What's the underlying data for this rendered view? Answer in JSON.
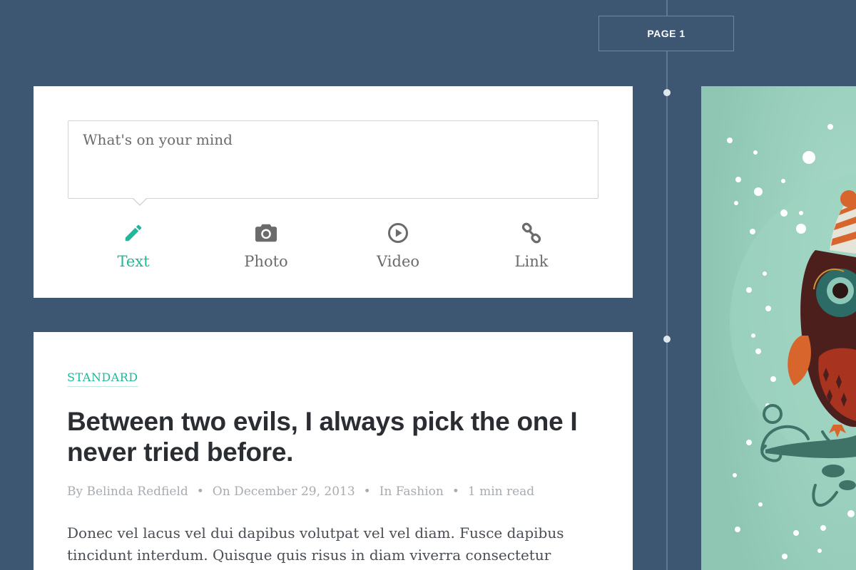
{
  "timeline": {
    "page_label": "PAGE 1"
  },
  "composer": {
    "placeholder": "What's on your mind",
    "post_types": [
      {
        "label": "Text",
        "icon": "pencil-icon",
        "active": true
      },
      {
        "label": "Photo",
        "icon": "camera-icon",
        "active": false
      },
      {
        "label": "Video",
        "icon": "play-circle-icon",
        "active": false
      },
      {
        "label": "Link",
        "icon": "link-icon",
        "active": false
      }
    ]
  },
  "article": {
    "category": "STANDARD",
    "title": "Between two evils, I always pick the one I never tried before.",
    "meta": {
      "author": "By Belinda Redfield",
      "date": "On December 29, 2013",
      "category": "In Fashion",
      "read_time": "1 min read"
    },
    "excerpt": "Donec vel lacus vel dui dapibus volutpat vel vel diam. Fusce dapibus tincidunt interdum. Quisque quis risus in diam viverra consectetur"
  },
  "colors": {
    "background": "#3d5672",
    "accent": "#1fb89a",
    "card": "#ffffff",
    "illustration_bg": "#8fc9b5"
  }
}
